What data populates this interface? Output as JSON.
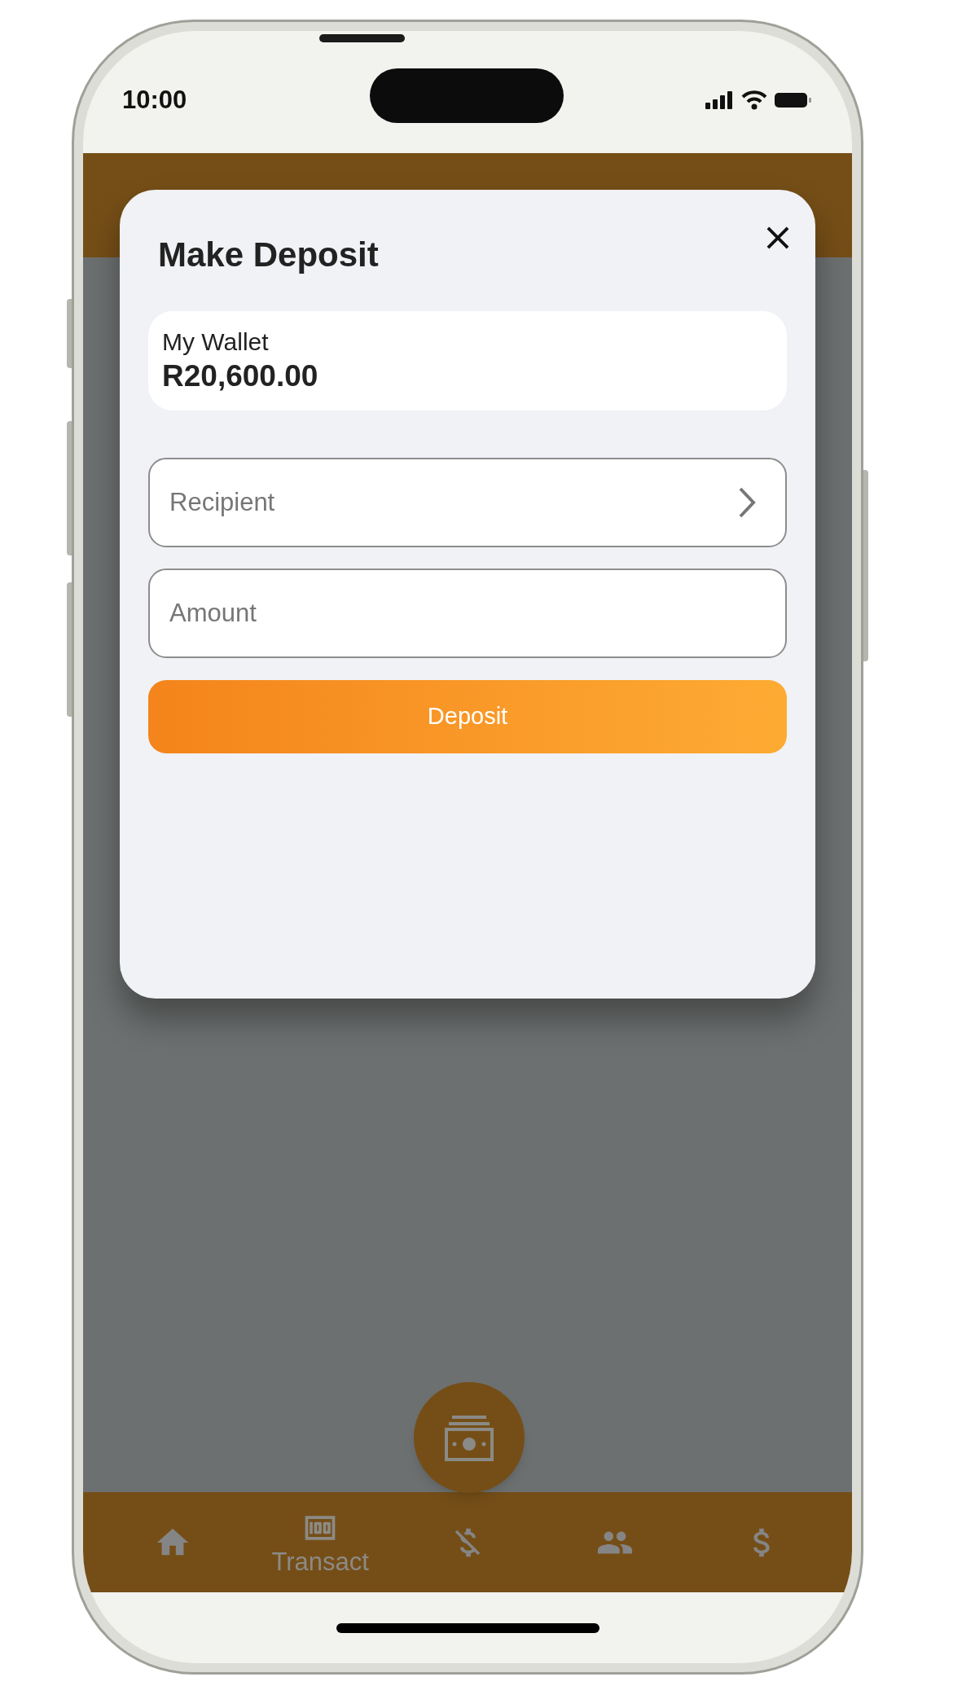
{
  "status_bar": {
    "time": "10:00"
  },
  "dialog": {
    "title": "Make Deposit",
    "wallet": {
      "label": "My Wallet",
      "balance": "R20,600.00"
    },
    "fields": [
      {
        "placeholder": "Recipient",
        "kind": "picker"
      },
      {
        "placeholder": "Amount",
        "kind": "text"
      }
    ],
    "submit": "Deposit"
  },
  "bottom_nav": [
    {
      "kind": "home",
      "selected": false
    },
    {
      "kind": "transact",
      "label": "Transact",
      "selected": true
    },
    {
      "kind": "no-money",
      "selected": false
    },
    {
      "kind": "people",
      "selected": false
    },
    {
      "kind": "dollar",
      "selected": false
    }
  ]
}
